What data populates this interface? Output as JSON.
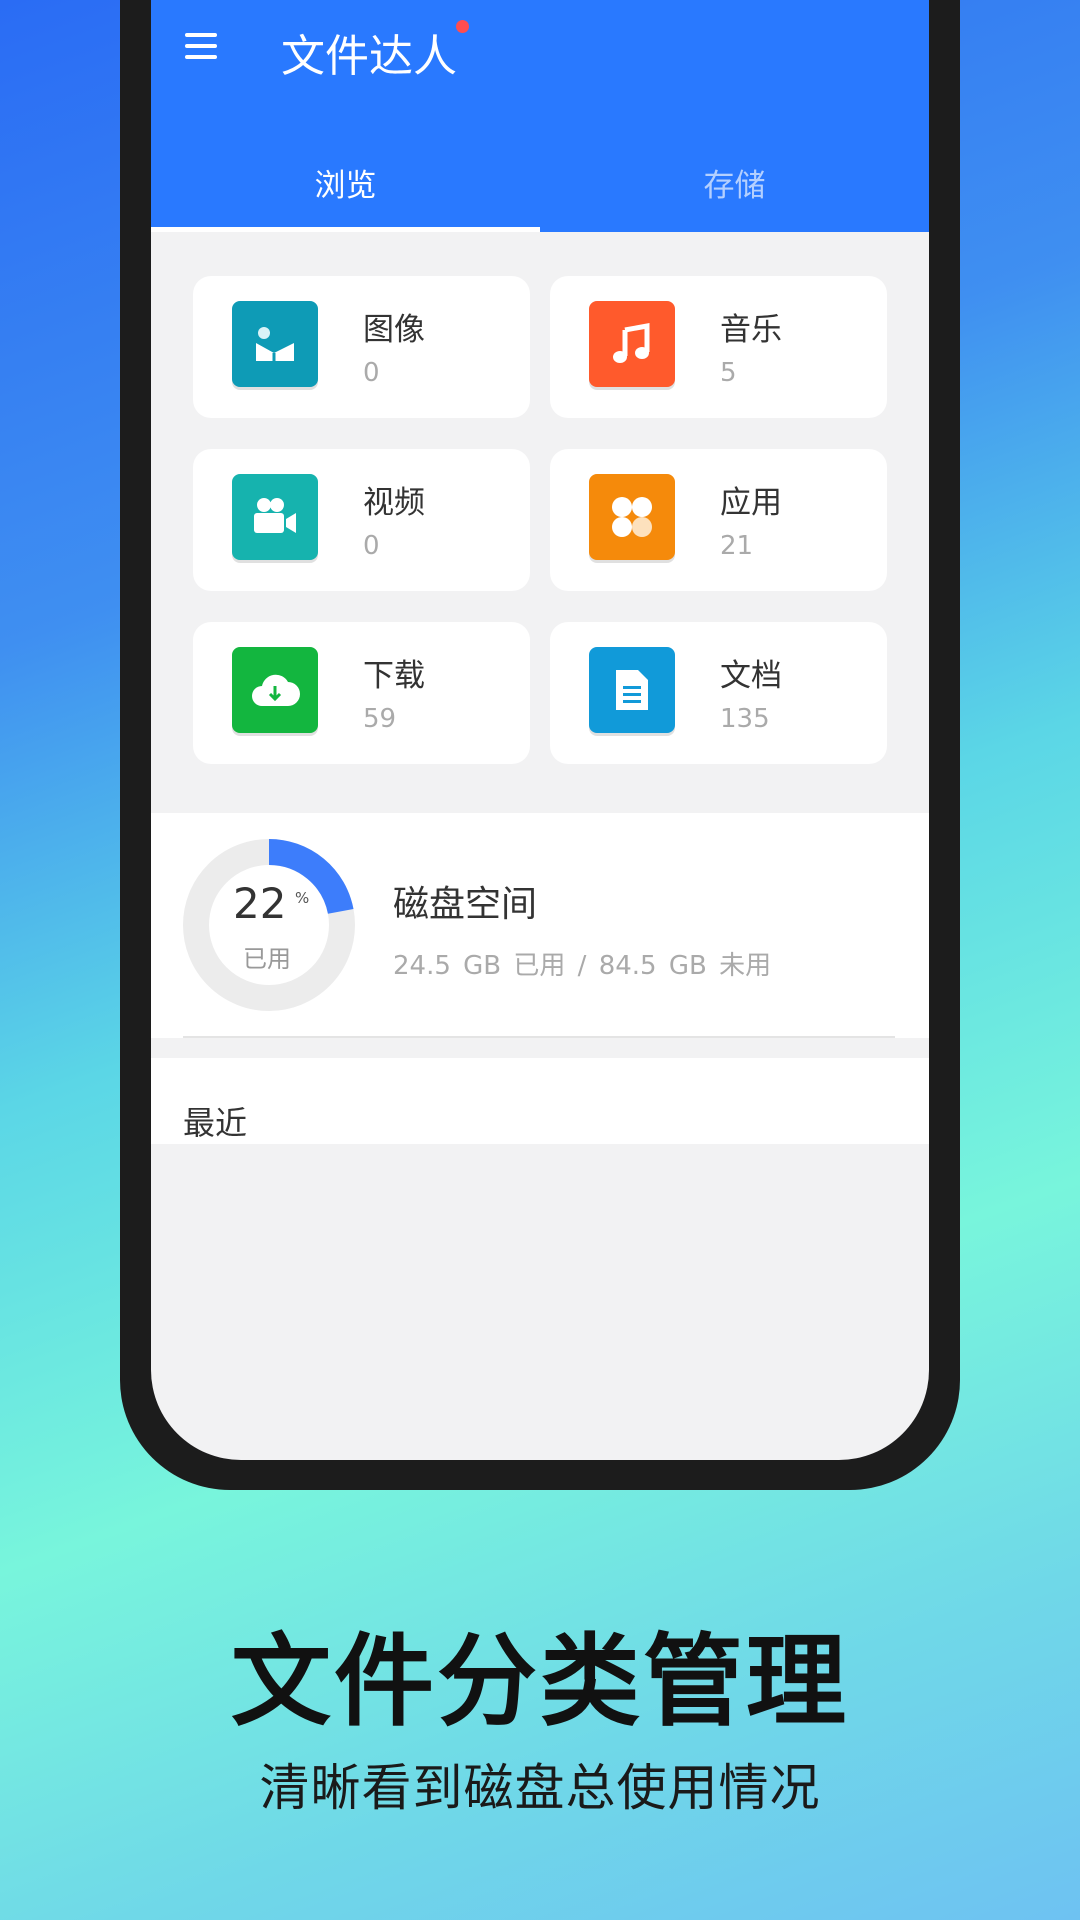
{
  "app": {
    "title": "文件达人"
  },
  "tabs": [
    {
      "label": "浏览",
      "active": true
    },
    {
      "label": "存储",
      "active": false
    }
  ],
  "categories": [
    {
      "name": "图像",
      "count": "0",
      "icon": "image-icon",
      "color": "#0e9bb6"
    },
    {
      "name": "音乐",
      "count": "5",
      "icon": "music-icon",
      "color": "#ff5a2c"
    },
    {
      "name": "视频",
      "count": "0",
      "icon": "video-camera-icon",
      "color": "#16b3ae"
    },
    {
      "name": "应用",
      "count": "21",
      "icon": "apps-icon",
      "color": "#f58a0b"
    },
    {
      "name": "下载",
      "count": "59",
      "icon": "cloud-download-icon",
      "color": "#13b63f"
    },
    {
      "name": "文档",
      "count": "135",
      "icon": "document-icon",
      "color": "#119ad9"
    }
  ],
  "disk": {
    "percent": 22,
    "percent_text": "22",
    "percent_sign": "%",
    "used_label": "已用",
    "title": "磁盘空间",
    "detail": "24.5 GB 已用 / 84.5 GB 未用",
    "accent_color": "#3d7dfb"
  },
  "recent": {
    "title": "最近"
  },
  "promo": {
    "headline": "文件分类管理",
    "subline": "清晰看到磁盘总使用情况"
  }
}
